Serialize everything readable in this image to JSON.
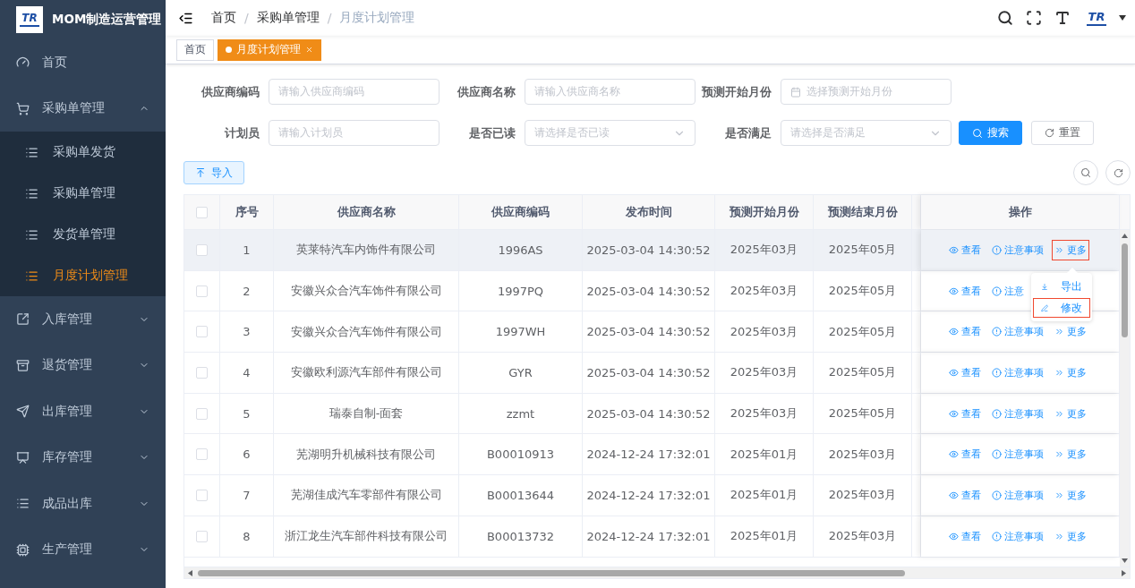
{
  "sidebar": {
    "logo": "TR",
    "title": "MOM制造运营管理",
    "items": [
      {
        "label": "首页"
      },
      {
        "label": "采购单管理",
        "expanded": true,
        "children": [
          {
            "label": "采购单发货",
            "selected": false
          },
          {
            "label": "采购单管理",
            "selected": false
          },
          {
            "label": "发货单管理",
            "selected": false
          },
          {
            "label": "月度计划管理",
            "selected": true
          }
        ]
      },
      {
        "label": "入库管理",
        "expanded": false
      },
      {
        "label": "退货管理",
        "expanded": false
      },
      {
        "label": "出库管理",
        "expanded": false
      },
      {
        "label": "库存管理",
        "expanded": false
      },
      {
        "label": "成品出库",
        "expanded": false
      },
      {
        "label": "生产管理",
        "expanded": false
      }
    ]
  },
  "header": {
    "breadcrumbs": [
      {
        "label": "首页"
      },
      {
        "separator": "/",
        "label": "采购单管理"
      },
      {
        "separator": "/",
        "label": "月度计划管理"
      }
    ],
    "logo": "TR"
  },
  "tabs": [
    {
      "label": "首页",
      "selected": false
    },
    {
      "label": "月度计划管理",
      "selected": true
    }
  ],
  "filters": [
    {
      "kind": "input",
      "label": "供应商编码",
      "placeholder": "请输入供应商编码"
    },
    {
      "kind": "input",
      "label": "供应商名称",
      "placeholder": "请输入供应商名称"
    },
    {
      "kind": "month",
      "label": "预测开始月份",
      "placeholder": "选择预测开始月份"
    },
    {
      "kind": "input",
      "label": "计划员",
      "placeholder": "请输入计划员"
    },
    {
      "kind": "select",
      "label": "是否已读",
      "placeholder": "请选择是否已读"
    },
    {
      "kind": "select",
      "label": "是否满足",
      "placeholder": "请选择是否满足"
    }
  ],
  "search_button": "搜索",
  "reset_button": "重置",
  "import_button": "导入",
  "table": {
    "header_checked": false,
    "columns": [
      "序号",
      "供应商名称",
      "供应商编码",
      "发布时间",
      "预测开始月份",
      "预测结束月份",
      "操作"
    ],
    "rows": [
      {
        "checked": false,
        "highlighted": true,
        "cells": [
          "1",
          "英莱特汽车内饰件有限公司",
          "1996AS",
          "2025-03-04 14:30:52",
          "2025年03月",
          "2025年05月"
        ],
        "actions": [
          {
            "kind": "view",
            "label": "查看",
            "outlined": false
          },
          {
            "kind": "notes",
            "label": "注意事项",
            "outlined": false
          },
          {
            "kind": "more",
            "label": "更多",
            "outlined": true
          }
        ]
      },
      {
        "checked": false,
        "highlighted": false,
        "cells": [
          "2",
          "安徽兴众合汽车饰件有限公司",
          "1997PQ",
          "2025-03-04 14:30:52",
          "2025年03月",
          "2025年05月"
        ],
        "actions": [
          {
            "kind": "view",
            "label": "查看",
            "outlined": false
          },
          {
            "kind": "notes",
            "label": "注意",
            "outlined": false
          }
        ]
      },
      {
        "checked": false,
        "highlighted": false,
        "cells": [
          "3",
          "安徽兴众合汽车饰件有限公司",
          "1997WH",
          "2025-03-04 14:30:52",
          "2025年03月",
          "2025年05月"
        ],
        "actions": [
          {
            "kind": "view",
            "label": "查看",
            "outlined": false
          },
          {
            "kind": "notes",
            "label": "注意事项",
            "outlined": false
          },
          {
            "kind": "more",
            "label": "更多",
            "outlined": false
          }
        ]
      },
      {
        "checked": false,
        "highlighted": false,
        "cells": [
          "4",
          "安徽欧利源汽车部件有限公司",
          "GYR",
          "2025-03-04 14:30:52",
          "2025年03月",
          "2025年05月"
        ],
        "actions": [
          {
            "kind": "view",
            "label": "查看",
            "outlined": false
          },
          {
            "kind": "notes",
            "label": "注意事项",
            "outlined": false
          },
          {
            "kind": "more",
            "label": "更多",
            "outlined": false
          }
        ]
      },
      {
        "checked": false,
        "highlighted": false,
        "cells": [
          "5",
          "瑞泰自制-面套",
          "zzmt",
          "2025-03-04 14:30:52",
          "2025年03月",
          "2025年05月"
        ],
        "actions": [
          {
            "kind": "view",
            "label": "查看",
            "outlined": false
          },
          {
            "kind": "notes",
            "label": "注意事项",
            "outlined": false
          },
          {
            "kind": "more",
            "label": "更多",
            "outlined": false
          }
        ]
      },
      {
        "checked": false,
        "highlighted": false,
        "cells": [
          "6",
          "芜湖明升机械科技有限公司",
          "B00010913",
          "2024-12-24 17:32:01",
          "2025年01月",
          "2025年03月"
        ],
        "actions": [
          {
            "kind": "view",
            "label": "查看",
            "outlined": false
          },
          {
            "kind": "notes",
            "label": "注意事项",
            "outlined": false
          },
          {
            "kind": "more",
            "label": "更多",
            "outlined": false
          }
        ]
      },
      {
        "checked": false,
        "highlighted": false,
        "cells": [
          "7",
          "芜湖佳成汽车零部件有限公司",
          "B00013644",
          "2024-12-24 17:32:01",
          "2025年01月",
          "2025年03月"
        ],
        "actions": [
          {
            "kind": "view",
            "label": "查看",
            "outlined": false
          },
          {
            "kind": "notes",
            "label": "注意事项",
            "outlined": false
          },
          {
            "kind": "more",
            "label": "更多",
            "outlined": false
          }
        ]
      },
      {
        "checked": false,
        "highlighted": false,
        "cells": [
          "8",
          "浙江龙生汽车部件科技有限公司",
          "B00013732",
          "2024-12-24 17:32:01",
          "2025年01月",
          "2025年03月"
        ],
        "actions": [
          {
            "kind": "view",
            "label": "查看",
            "outlined": false
          },
          {
            "kind": "notes",
            "label": "注意事项",
            "outlined": false
          },
          {
            "kind": "more",
            "label": "更多",
            "outlined": false
          }
        ]
      }
    ]
  },
  "more_menu": [
    {
      "kind": "export",
      "label": "导出",
      "outlined": false
    },
    {
      "kind": "edit",
      "label": "修改",
      "outlined": true
    }
  ]
}
